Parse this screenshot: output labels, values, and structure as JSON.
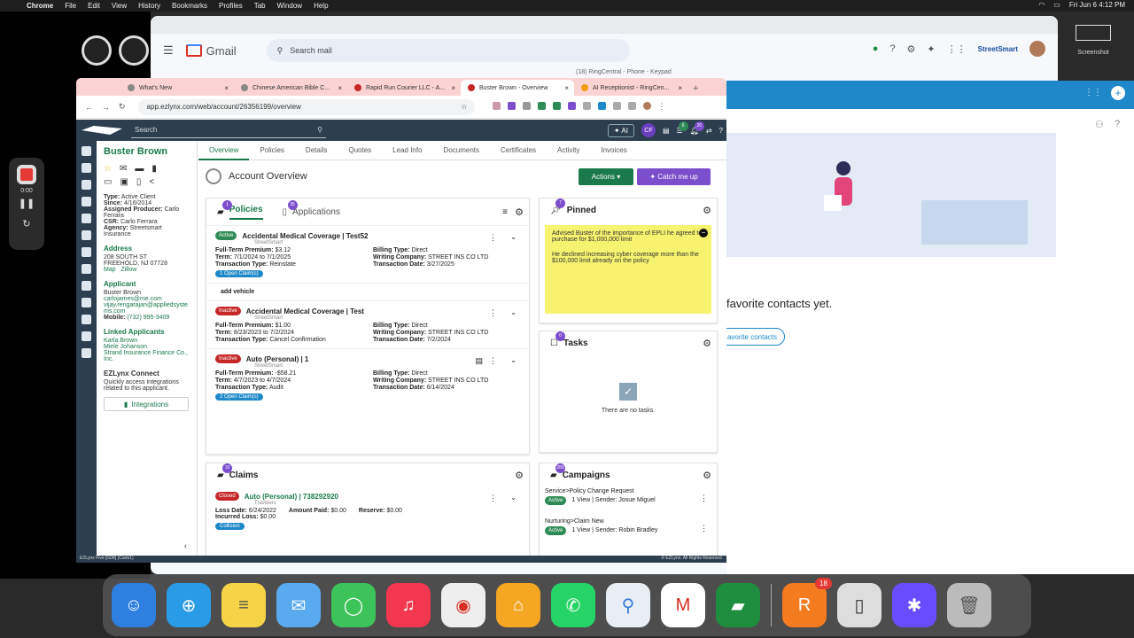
{
  "menubar": {
    "app": "Chrome",
    "items": [
      "File",
      "Edit",
      "View",
      "History",
      "Bookmarks",
      "Profiles",
      "Tab",
      "Window",
      "Help"
    ],
    "clock": "Fri Jun 6  4:12 PM"
  },
  "gmail": {
    "title": "Gmail",
    "search_placeholder": "Search mail",
    "brand": "StreetSmart"
  },
  "ringcentral": {
    "window_title": "(18) RingCentral - Phone - Keypad",
    "fav_text": "favorite contacts yet.",
    "fav_btn": "avorite contacts"
  },
  "recorder": {
    "time": "0:00"
  },
  "screenshot": {
    "label": "Screenshot"
  },
  "tabs": [
    {
      "label": "What's New"
    },
    {
      "label": "Chinese American Bible C..."
    },
    {
      "label": "Rapid Run Courier LLC - A..."
    },
    {
      "label": "Buster Brown - Overview"
    },
    {
      "label": "AI Receptionist - RingCen..."
    }
  ],
  "url": "app.ezlynx.com/web/account/26356199/overview",
  "ez": {
    "search": "Search",
    "ai": "AI",
    "initials": "CF",
    "notif_count": "20",
    "list_count": "6"
  },
  "client": {
    "name": "Buster Brown",
    "type_label": "Type:",
    "type": "Active Client",
    "since_label": "Since:",
    "since": "4/16/2014",
    "producer_label": "Assigned Producer:",
    "producer": "Carlo Ferrara",
    "csr_label": "CSR:",
    "csr": "Carlo Ferrara",
    "agency_label": "Agency:",
    "agency": "Streetsmart Insurance",
    "address_h": "Address",
    "addr1": "208 SOUTH ST",
    "addr2": "FREEHOLD, NJ 07728",
    "map": "Map",
    "zillow": "Zillow",
    "applicant_h": "Applicant",
    "applicant": "Buster Brown",
    "email1": "carlojames@me.com",
    "email2": "vijay.rengarajan@appliedsystems.com",
    "mobile_label": "Mobile:",
    "mobile": "(732) 995-3409",
    "linked_h": "Linked Applicants",
    "linked": [
      "Karla Brown",
      "Miele Johanson",
      "Strand Insurance Finance Co., Inc."
    ],
    "connect_h": "EZLynx Connect",
    "connect_text": "Quickly access integrations related to this applicant.",
    "integrations": "Integrations"
  },
  "navtabs": [
    "Overview",
    "Policies",
    "Details",
    "Quotes",
    "Lead Info",
    "Documents",
    "Certificates",
    "Activity",
    "Invoices"
  ],
  "overview": {
    "title": "Account Overview",
    "actions": "Actions",
    "catch": "Catch me up"
  },
  "policies_card": {
    "tab_policies": "Policies",
    "tab_applications": "Applications",
    "policies_count": "1",
    "applications_count": "35",
    "items": [
      {
        "status": "Active",
        "title": "Accidental Medical Coverage | Test52",
        "carrier": "StreetSmart",
        "premium": "$3.12",
        "term": "7/1/2024 to 7/1/2025",
        "ttype": "Reinstate",
        "billing": "Direct",
        "company": "STREET INS CO LTD",
        "tdate": "3/27/2025",
        "claims": "1 Open Claim(s)"
      },
      {
        "status": "Inactive",
        "title": "Accidental Medical Coverage | Test",
        "carrier": "StreetSmart",
        "premium": "$1.00",
        "term": "8/23/2023 to 7/2/2024",
        "ttype": "Cancel Confirmation",
        "billing": "Direct",
        "company": "STREET INS CO LTD",
        "tdate": "7/2/2024"
      },
      {
        "status": "Inactive",
        "title": "Auto (Personal) | 1",
        "carrier": "StreetSmart",
        "premium": "-$58.21",
        "term": "4/7/2023 to 4/7/2024",
        "ttype": "Audit",
        "billing": "Direct",
        "company": "STREET INS CO LTD",
        "tdate": "6/14/2024",
        "claims": "2 Open Claim(s)"
      }
    ],
    "add_vehicle": "add vehicle",
    "labels": {
      "premium": "Full-Term Premium:",
      "term": "Term:",
      "ttype": "Transaction Type:",
      "billing": "Billing Type:",
      "company": "Writing Company:",
      "tdate": "Transaction Date:"
    }
  },
  "claims_card": {
    "title": "Claims",
    "count": "10",
    "status": "Closed",
    "policy": "Auto (Personal) | 738292920",
    "carrier": "Travelers",
    "loss_label": "Loss Date:",
    "loss": "6/24/2022",
    "paid_label": "Amount Paid:",
    "paid": "$0.00",
    "reserve_label": "Reserve:",
    "reserve": "$0.00",
    "incurred_label": "Incurred Loss:",
    "incurred": "$0.00",
    "tag": "Collision"
  },
  "pinned_card": {
    "title": "Pinned",
    "count": "7",
    "note1": "Advised Buster of the importance of EPLI he agreed to purchase for $1,000,000 limit",
    "note2": "He declined increasing cyber coverage more than the $100,000 limit already on the policy"
  },
  "tasks_card": {
    "title": "Tasks",
    "count": "0",
    "empty": "There are no tasks."
  },
  "campaigns_card": {
    "title": "Campaigns",
    "count": "280",
    "items": [
      {
        "name": "Service>Policy Change Request",
        "status": "Active",
        "detail": "1 View | Sender: Josue Miguel"
      },
      {
        "name": "Nurturing>Claim New",
        "status": "Active",
        "detail": "1 View | Sender: Robin Bradley"
      }
    ]
  },
  "statusbar": {
    "left": "EZLynx Five [G08] (Carlo1)",
    "right": "© EZLynx. All Rights Reserved."
  },
  "dock": {
    "badge": "18"
  }
}
